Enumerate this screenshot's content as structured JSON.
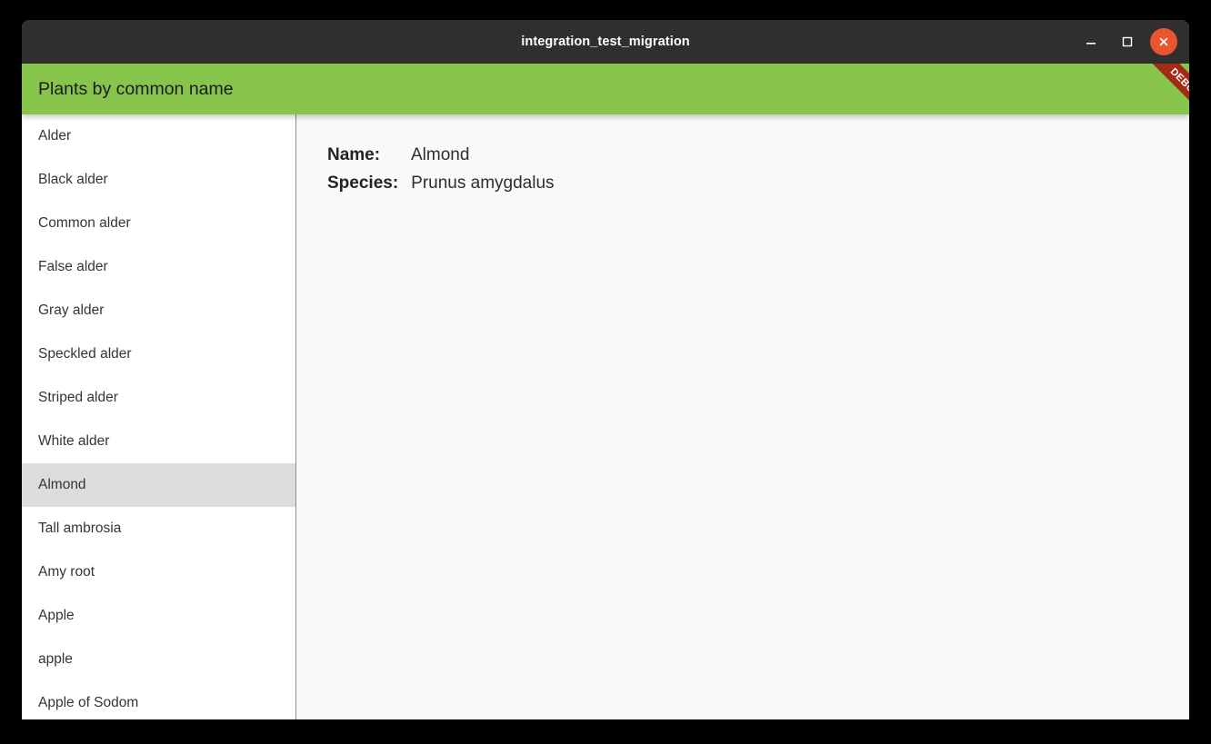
{
  "window": {
    "title": "integration_test_migration",
    "controls": [
      {
        "name": "minimize-button",
        "glyph": "minimize-icon",
        "label": "Minimize"
      },
      {
        "name": "maximize-button",
        "glyph": "maximize-icon",
        "label": "Maximize"
      },
      {
        "name": "close-button",
        "glyph": "close-icon",
        "label": "Close"
      }
    ]
  },
  "appbar": {
    "title": "Plants by common name",
    "color": "#87c44c"
  },
  "debug_ribbon": {
    "label": "DEBUG",
    "color": "#a32a14"
  },
  "sidebar": {
    "items": [
      {
        "label": "Alder",
        "selected": false
      },
      {
        "label": "Black alder",
        "selected": false
      },
      {
        "label": "Common alder",
        "selected": false
      },
      {
        "label": "False alder",
        "selected": false
      },
      {
        "label": "Gray alder",
        "selected": false
      },
      {
        "label": "Speckled alder",
        "selected": false
      },
      {
        "label": "Striped alder",
        "selected": false
      },
      {
        "label": "White alder",
        "selected": false
      },
      {
        "label": "Almond",
        "selected": true
      },
      {
        "label": "Tall ambrosia",
        "selected": false
      },
      {
        "label": "Amy root",
        "selected": false
      },
      {
        "label": "Apple",
        "selected": false
      },
      {
        "label": "apple",
        "selected": false
      },
      {
        "label": "Apple of Sodom",
        "selected": false
      }
    ],
    "selected_color": "#dcdcdc"
  },
  "detail": {
    "rows": [
      {
        "label": "Name:",
        "value": "Almond"
      },
      {
        "label": "Species:",
        "value": "Prunus amygdalus"
      }
    ]
  }
}
